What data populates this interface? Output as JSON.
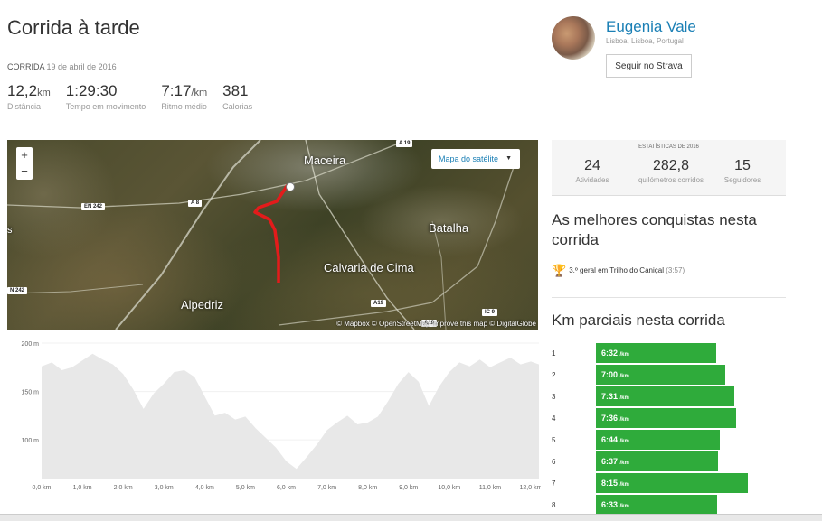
{
  "activity": {
    "title": "Corrida à tarde",
    "type_label": "CORRIDA",
    "date": "19 de abril de 2016",
    "stats": [
      {
        "value": "12,2",
        "unit": "km",
        "label": "Distância"
      },
      {
        "value": "1:29:30",
        "unit": "",
        "label": "Tempo em movimento"
      },
      {
        "value": "7:17",
        "unit": "/km",
        "label": "Ritmo médio"
      },
      {
        "value": "381",
        "unit": "",
        "label": "Calorias"
      }
    ]
  },
  "athlete": {
    "name": "Eugenia Vale",
    "location": "Lisboa, Lisboa, Portugal",
    "follow_label": "Seguir no Strava"
  },
  "map": {
    "zoom_in": "+",
    "zoom_out": "−",
    "layer_selector": "Mapa do satélite",
    "towns": [
      "Maceira",
      "Batalha",
      "Calvaria de Cima",
      "Alpedriz"
    ],
    "roads": [
      "A 19",
      "EN 242",
      "A 8",
      "N 242",
      "A19",
      "IC 9",
      "A19"
    ],
    "edge_text": "s",
    "attribution": "© Mapbox © OpenStreetMap Improve this map © DigitalGlobe"
  },
  "elevation": {
    "y_ticks": [
      "200 m",
      "150 m",
      "100 m"
    ],
    "x_ticks": [
      "0,0 km",
      "1,0 km",
      "2,0 km",
      "3,0 km",
      "4,0 km",
      "5,0 km",
      "6,0 km",
      "7,0 km",
      "8,0 km",
      "9,0 km",
      "10,0 km",
      "11,0 km",
      "12,0 km"
    ]
  },
  "chart_data": {
    "type": "area",
    "title": "",
    "xlabel": "",
    "ylabel": "",
    "x_unit": "km",
    "y_unit": "m",
    "xlim": [
      0,
      12.2
    ],
    "ylim": [
      60,
      200
    ],
    "grid": true,
    "x": [
      0,
      0.25,
      0.5,
      0.75,
      1.0,
      1.25,
      1.5,
      1.75,
      2.0,
      2.25,
      2.5,
      2.75,
      3.0,
      3.25,
      3.5,
      3.75,
      4.0,
      4.25,
      4.5,
      4.75,
      5.0,
      5.25,
      5.5,
      5.75,
      6.0,
      6.25,
      6.5,
      6.75,
      7.0,
      7.25,
      7.5,
      7.75,
      8.0,
      8.25,
      8.5,
      8.75,
      9.0,
      9.25,
      9.5,
      9.75,
      10.0,
      10.25,
      10.5,
      10.75,
      11.0,
      11.25,
      11.5,
      11.75,
      12.0,
      12.2
    ],
    "series": [
      {
        "values": [
          176,
          180,
          172,
          175,
          182,
          189,
          183,
          178,
          168,
          152,
          132,
          148,
          158,
          170,
          172,
          165,
          145,
          125,
          128,
          121,
          124,
          112,
          102,
          92,
          78,
          70,
          82,
          95,
          110,
          118,
          125,
          116,
          118,
          124,
          140,
          158,
          170,
          160,
          135,
          155,
          170,
          180,
          176,
          183,
          175,
          180,
          185,
          178,
          181,
          178
        ]
      }
    ]
  },
  "year_stats": {
    "header": "ESTATÍSTICAS DE 2016",
    "items": [
      {
        "value": "24",
        "label": "Atividades"
      },
      {
        "value": "282,8",
        "label": "quilómetros corridos"
      },
      {
        "value": "15",
        "label": "Seguidores"
      }
    ]
  },
  "achievements": {
    "title": "As melhores conquistas nesta corrida",
    "items": [
      {
        "text": "3.º geral em Trilho do Caniçal",
        "time": "(3:57)"
      }
    ]
  },
  "splits": {
    "title": "Km parciais nesta corrida",
    "unit": "/km",
    "bar_color": "#2fab3b",
    "items": [
      {
        "km": "1",
        "pace": "6:32",
        "seconds": 392
      },
      {
        "km": "2",
        "pace": "7:00",
        "seconds": 420
      },
      {
        "km": "3",
        "pace": "7:31",
        "seconds": 451
      },
      {
        "km": "4",
        "pace": "7:36",
        "seconds": 456
      },
      {
        "km": "5",
        "pace": "6:44",
        "seconds": 404
      },
      {
        "km": "6",
        "pace": "6:37",
        "seconds": 397
      },
      {
        "km": "7",
        "pace": "8:15",
        "seconds": 495
      },
      {
        "km": "8",
        "pace": "6:33",
        "seconds": 393
      }
    ]
  }
}
